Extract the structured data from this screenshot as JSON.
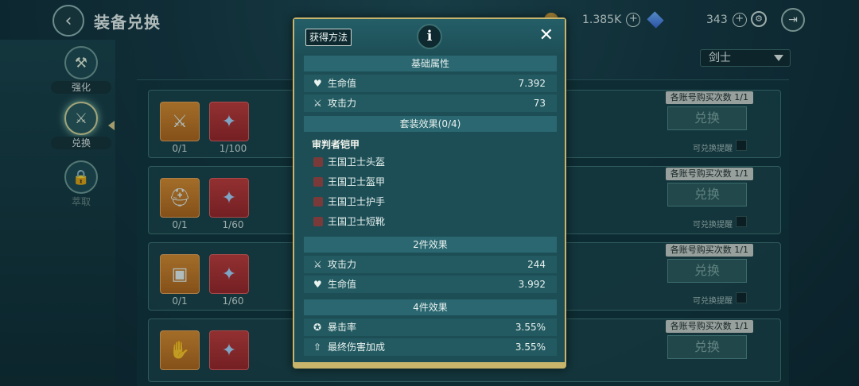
{
  "header": {
    "title": "装备兑换",
    "gold": "1.385K",
    "gems": "343"
  },
  "sidebar": {
    "items": [
      {
        "label": "强化"
      },
      {
        "label": "兑换"
      },
      {
        "label": "萃取"
      }
    ]
  },
  "filter": {
    "selected": "剑士"
  },
  "rows": [
    {
      "count1": "0/1",
      "count2": "1/100",
      "limit": "各账号购买次数 1/1",
      "button": "兑换",
      "remind": "可兑换提醒"
    },
    {
      "count1": "0/1",
      "count2": "1/60",
      "limit": "各账号购买次数 1/1",
      "button": "兑换",
      "remind": "可兑换提醒"
    },
    {
      "count1": "0/1",
      "count2": "1/60",
      "limit": "各账号购买次数 1/1",
      "button": "兑换",
      "remind": "可兑换提醒"
    },
    {
      "count1": "",
      "count2": "",
      "limit": "各账号购买次数 1/1",
      "button": "兑换",
      "remind": ""
    }
  ],
  "modal": {
    "source_button": "获得方法",
    "base": {
      "heading": "基础属性",
      "stats": [
        {
          "label": "生命值",
          "value": "7.392",
          "icon": "heart-icon"
        },
        {
          "label": "攻击力",
          "value": "73",
          "icon": "swords-icon"
        }
      ]
    },
    "set": {
      "heading": "套装效果(0/4)",
      "name": "审判者铠甲",
      "items": [
        "王国卫士头盔",
        "王国卫士盔甲",
        "王国卫士护手",
        "王国卫士短靴"
      ]
    },
    "two_piece": {
      "heading": "2件效果",
      "stats": [
        {
          "label": "攻击力",
          "value": "244",
          "icon": "swords-icon"
        },
        {
          "label": "生命值",
          "value": "3.992",
          "icon": "heart-icon"
        }
      ]
    },
    "four_piece": {
      "heading": "4件效果",
      "stats": [
        {
          "label": "暴击率",
          "value": "3.55%",
          "icon": "crit-icon"
        },
        {
          "label": "最终伤害加成",
          "value": "3.55%",
          "icon": "damage-up-icon"
        }
      ]
    }
  }
}
